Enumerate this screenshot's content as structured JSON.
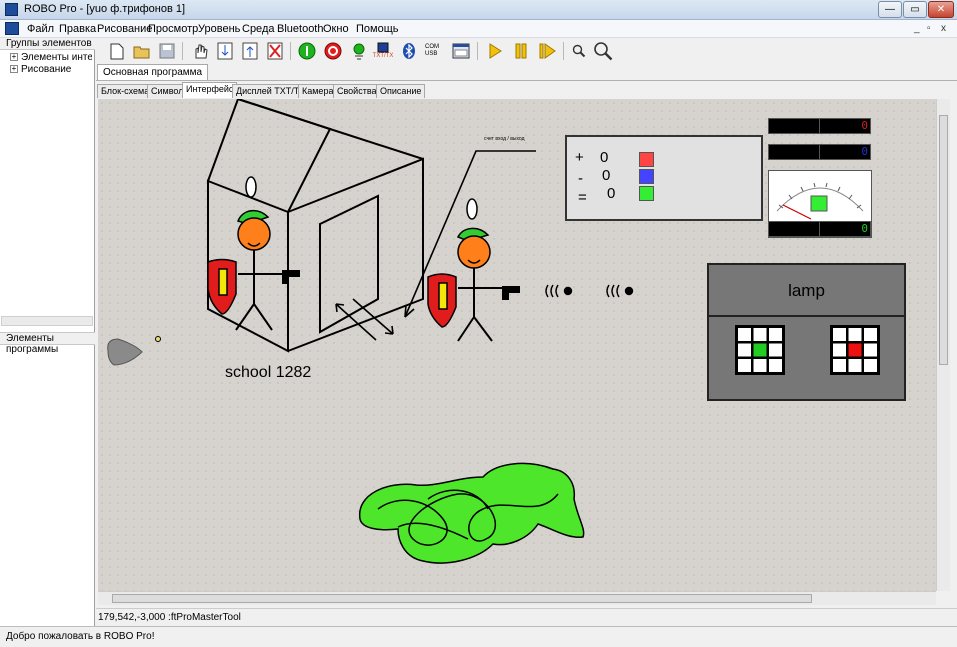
{
  "window": {
    "title": "ROBO Pro - [yuo ф.трифонов 1]",
    "min_label": "—",
    "max_label": "▭",
    "close_label": "✕"
  },
  "menu": {
    "items": [
      "Файл",
      "Правка",
      "Рисование",
      "Просмотр",
      "Уровень",
      "Среда",
      "Bluetooth",
      "Окно",
      "Помощь"
    ],
    "mdi_min": "_",
    "mdi_max": "▫",
    "mdi_close": "x"
  },
  "toolbar": {
    "icons": [
      "new-icon",
      "open-icon",
      "save-icon",
      "hand-icon",
      "download-icon",
      "upload-icon",
      "delete-icon",
      "start-icon",
      "stop-icon",
      "online-icon",
      "txt-tx-icon",
      "bluetooth-icon",
      "com-usb-icon",
      "control-panel-icon",
      "play-icon",
      "pause-icon",
      "step-icon",
      "zoom-out-icon",
      "zoom-in-icon"
    ],
    "com_usb_label": "COM USB",
    "txt_label": "TXT/TX"
  },
  "left_panel": {
    "groups_title": "Группы элементов",
    "tree": [
      "Элементы интерфейса",
      "Рисование"
    ],
    "program_title": "Элементы программы"
  },
  "tabs": {
    "program_tab": "Основная программа",
    "subtabs": [
      "Блок-схема",
      "Символ",
      "Интерфейс",
      "Дисплей TXT/TX",
      "Камера",
      "Свойства",
      "Описание"
    ],
    "active_index": 2
  },
  "canvas": {
    "school_label": "school 1282",
    "annotation": "счет вход / выход",
    "counter_panel": {
      "rows": [
        {
          "symbol": "+",
          "value": "0",
          "color": "#ff4444"
        },
        {
          "symbol": "-",
          "value": "0",
          "color": "#4444ff"
        },
        {
          "symbol": "=",
          "value": "0",
          "color": "#33ee33"
        }
      ]
    },
    "displays": [
      {
        "value": "0",
        "color": "#cc2222"
      },
      {
        "value": "0",
        "color": "#2233cc"
      },
      {
        "value": "0",
        "color": "#22cc22"
      }
    ],
    "lamp_label": "lamp",
    "lamp_colors": {
      "left": "#22cc22",
      "right": "#ee1111"
    }
  },
  "coordinates": "179,542,-3,000 :ftProMasterTool",
  "status": "Добро пожаловать в ROBO Pro!"
}
